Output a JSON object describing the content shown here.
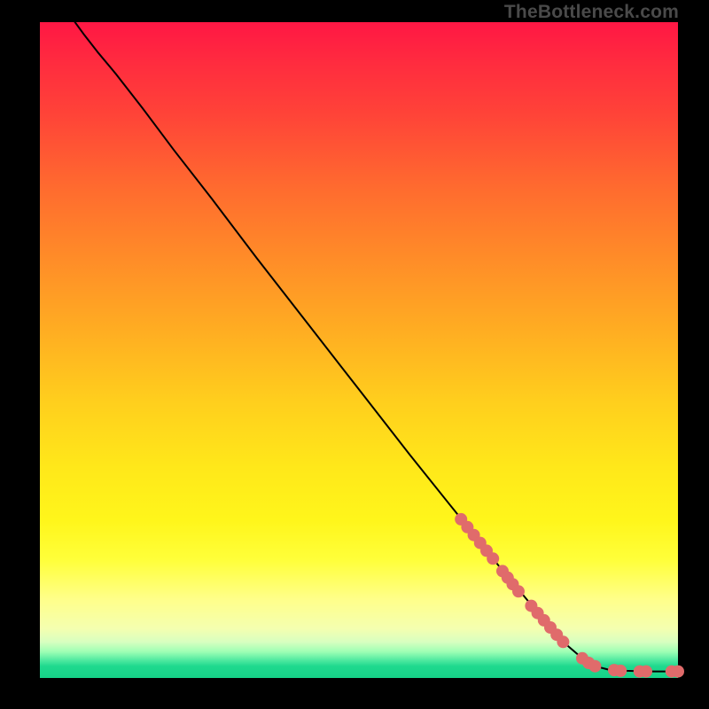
{
  "watermark": "TheBottleneck.com",
  "chart_data": {
    "type": "line",
    "title": "",
    "xlabel": "",
    "ylabel": "",
    "xlim": [
      0,
      100
    ],
    "ylim": [
      0,
      100
    ],
    "grid": false,
    "curve": [
      {
        "x": 5.5,
        "y": 100
      },
      {
        "x": 7,
        "y": 98
      },
      {
        "x": 9,
        "y": 95.5
      },
      {
        "x": 12,
        "y": 92
      },
      {
        "x": 16,
        "y": 87
      },
      {
        "x": 21,
        "y": 80.5
      },
      {
        "x": 27,
        "y": 73
      },
      {
        "x": 34,
        "y": 64
      },
      {
        "x": 42,
        "y": 54
      },
      {
        "x": 50,
        "y": 44
      },
      {
        "x": 58,
        "y": 34
      },
      {
        "x": 65,
        "y": 25.5
      },
      {
        "x": 72,
        "y": 17
      },
      {
        "x": 78,
        "y": 10
      },
      {
        "x": 82,
        "y": 5.5
      },
      {
        "x": 85,
        "y": 3
      },
      {
        "x": 87,
        "y": 1.8
      },
      {
        "x": 89,
        "y": 1.3
      },
      {
        "x": 92,
        "y": 1.1
      },
      {
        "x": 95,
        "y": 1.0
      },
      {
        "x": 98,
        "y": 1.0
      },
      {
        "x": 100,
        "y": 1.0
      }
    ],
    "markers": [
      {
        "x": 66,
        "y": 24.2
      },
      {
        "x": 67,
        "y": 23.0
      },
      {
        "x": 68,
        "y": 21.8
      },
      {
        "x": 69,
        "y": 20.6
      },
      {
        "x": 70,
        "y": 19.4
      },
      {
        "x": 71,
        "y": 18.2
      },
      {
        "x": 72.5,
        "y": 16.3
      },
      {
        "x": 73.3,
        "y": 15.3
      },
      {
        "x": 74.1,
        "y": 14.3
      },
      {
        "x": 75,
        "y": 13.2
      },
      {
        "x": 77,
        "y": 11
      },
      {
        "x": 78,
        "y": 9.9
      },
      {
        "x": 79,
        "y": 8.8
      },
      {
        "x": 80,
        "y": 7.7
      },
      {
        "x": 81,
        "y": 6.6
      },
      {
        "x": 82,
        "y": 5.5
      },
      {
        "x": 85,
        "y": 3
      },
      {
        "x": 86,
        "y": 2.3
      },
      {
        "x": 87,
        "y": 1.8
      },
      {
        "x": 90,
        "y": 1.2
      },
      {
        "x": 91,
        "y": 1.1
      },
      {
        "x": 94,
        "y": 1.0
      },
      {
        "x": 95,
        "y": 1.0
      },
      {
        "x": 99,
        "y": 1.0
      },
      {
        "x": 100,
        "y": 1.0
      }
    ],
    "marker_color": "#e06b6b",
    "line_color": "#000000"
  }
}
